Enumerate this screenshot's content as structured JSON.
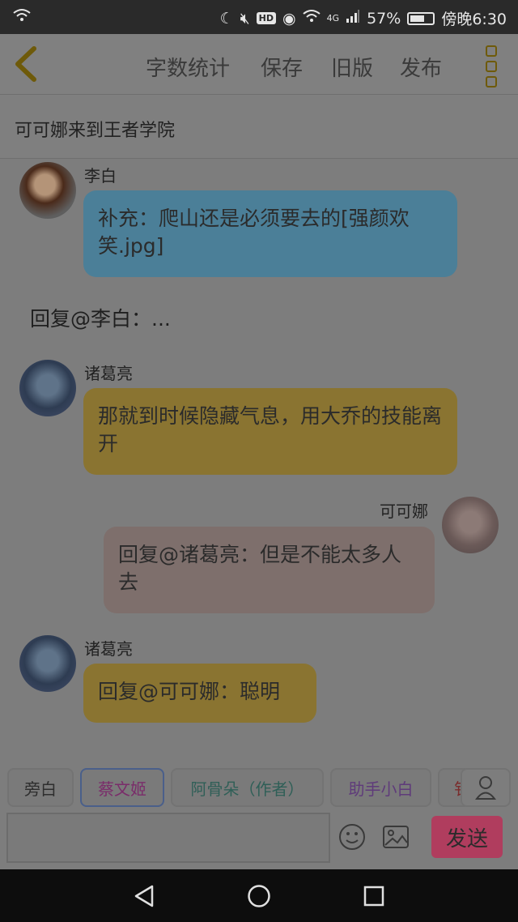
{
  "status_bar": {
    "battery": "57%",
    "time": "傍晚6:30",
    "hd": "HD",
    "network": "4G"
  },
  "toolbar": {
    "back_icon": "chevron-left-icon",
    "word_count": "字数统计",
    "save": "保存",
    "old_version": "旧版",
    "publish": "发布",
    "more_icon": "more-vertical-icon"
  },
  "story": {
    "title": "可可娜来到王者学院"
  },
  "messages": [
    {
      "sender": "李白",
      "text": "补充：爬山还是必须要去的[强颜欢笑.jpg]",
      "color": "#4b7f98"
    },
    {
      "narration": "回复@李白：..."
    },
    {
      "sender": "诸葛亮",
      "text": "那就到时候隐藏气息，用大乔的技能离开",
      "color": "#8a7431"
    },
    {
      "sender": "可可娜",
      "text": "回复@诸葛亮：但是不能太多人去",
      "color": "#7e6f6c"
    },
    {
      "sender": "诸葛亮",
      "text": "回复@可可娜：聪明",
      "color": "#8a7431"
    }
  ],
  "characters": [
    "旁白",
    "蔡文姬",
    "阿骨朵（作者）",
    "助手小白",
    "钅"
  ],
  "character_colors": [
    "#2e2e2e",
    "#7a2c6a",
    "#2f5f57",
    "#5f3b7a",
    "#7a2c2c"
  ],
  "composer": {
    "placeholder": "",
    "send": "发送",
    "emoji_icon": "smiley-icon",
    "image_icon": "image-icon",
    "user_icon": "user-icon"
  }
}
